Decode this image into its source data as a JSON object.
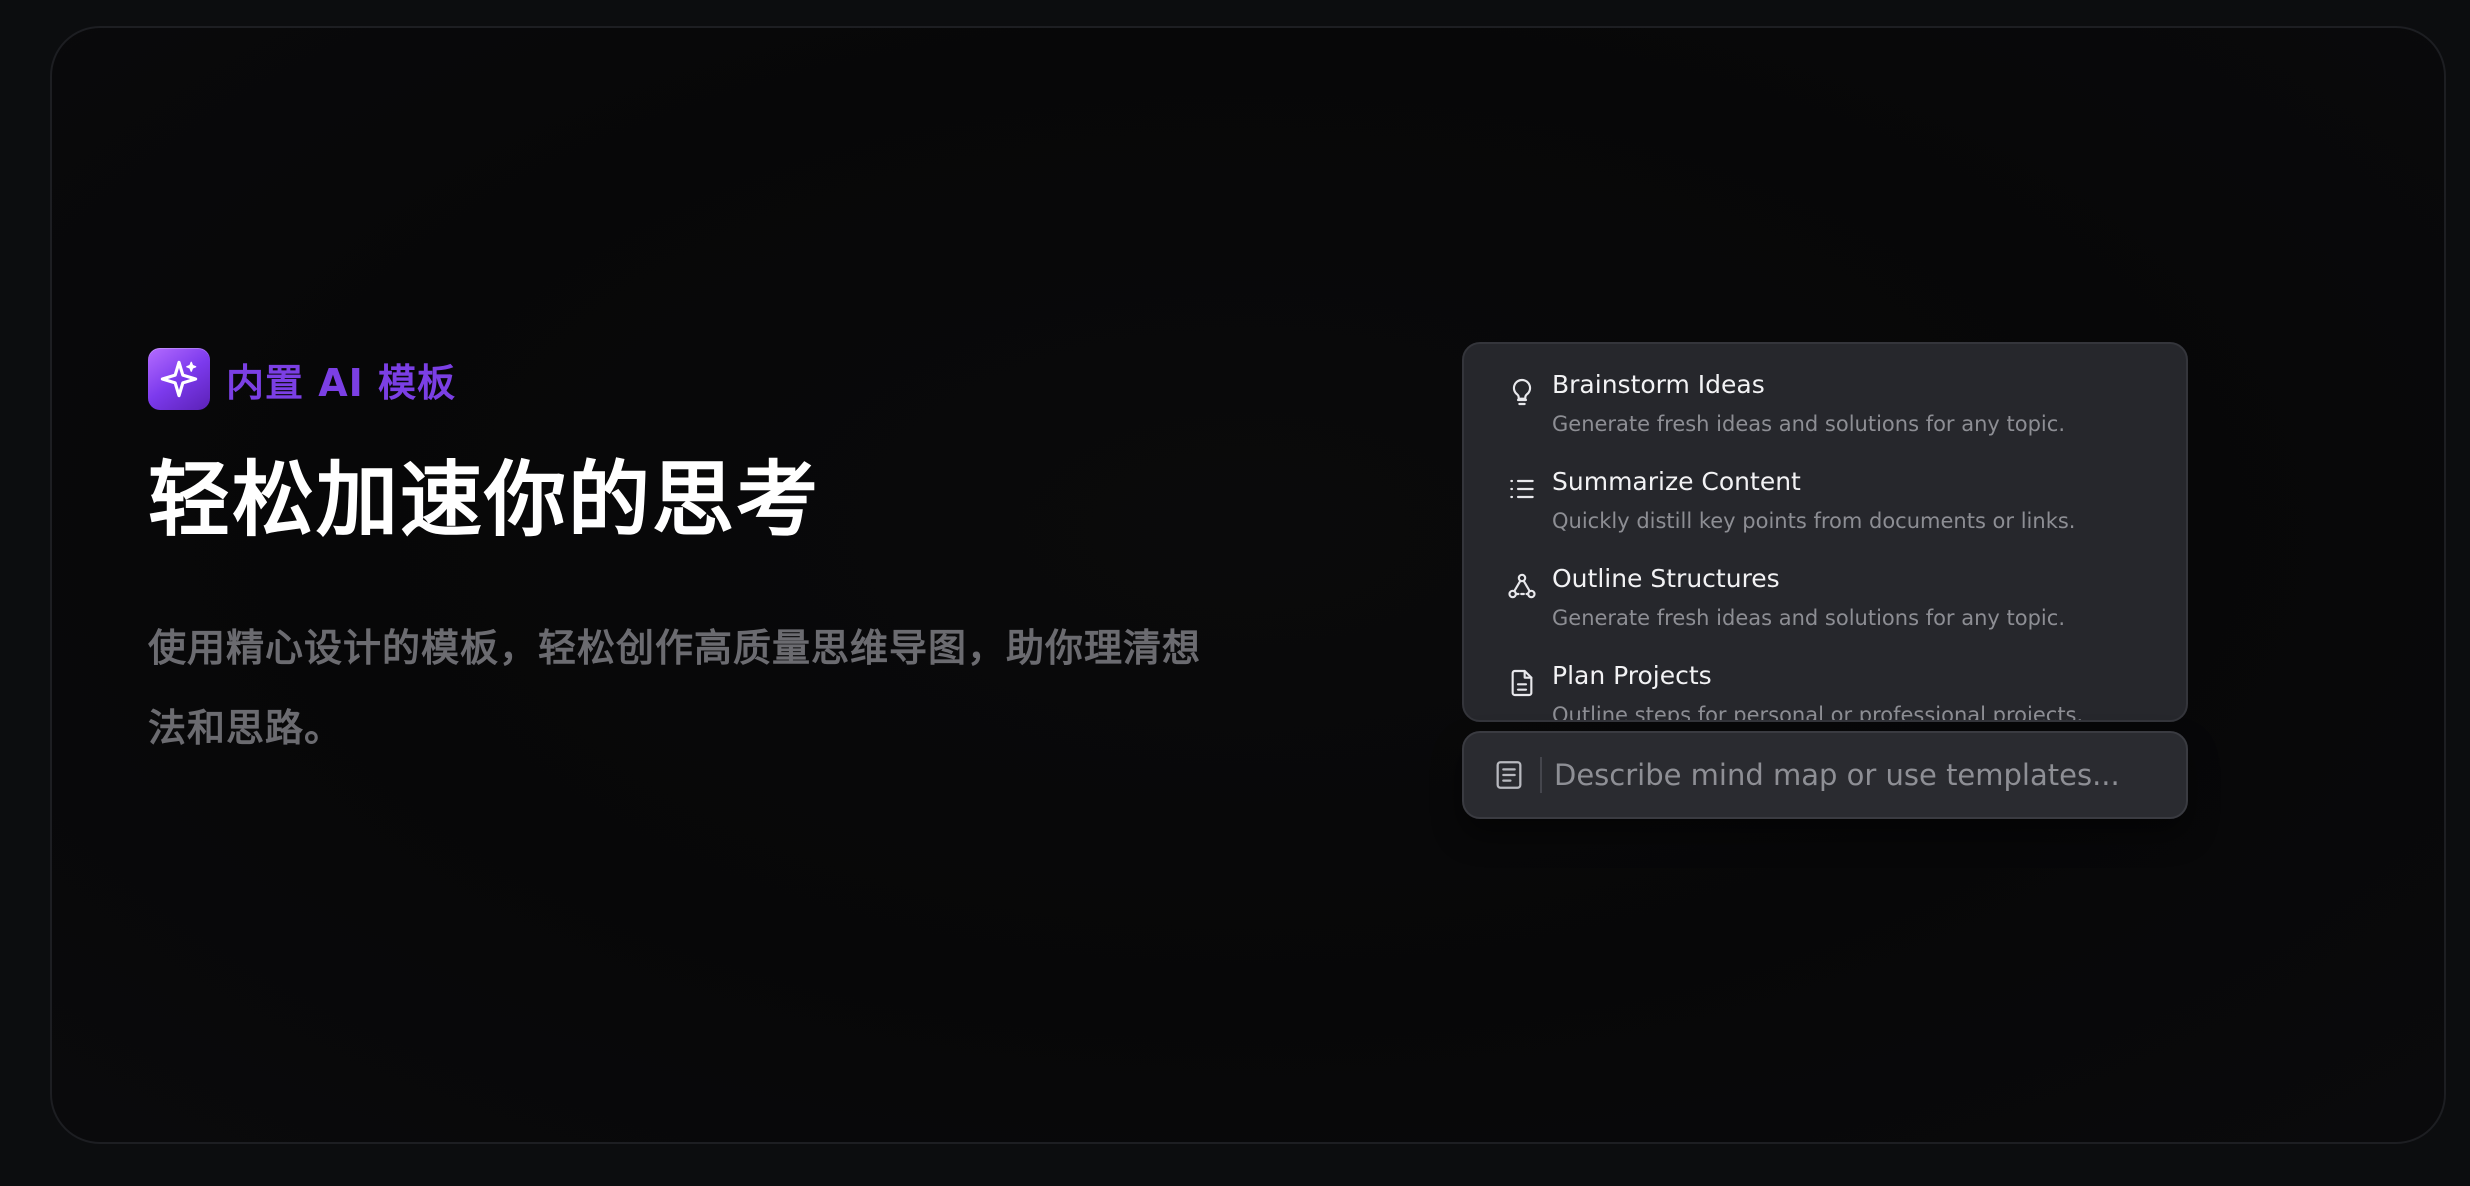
{
  "hero": {
    "badge_label": "内置 AI 模板",
    "headline": "轻松加速你的思考",
    "description": "使用精心设计的模板，轻松创作高质量思维导图，助你理清想法和思路。"
  },
  "templates": [
    {
      "icon": "lightbulb-icon",
      "title": "Brainstorm Ideas",
      "description": "Generate fresh ideas and solutions for any topic."
    },
    {
      "icon": "list-icon",
      "title": "Summarize Content",
      "description": "Quickly distill key points from documents or links."
    },
    {
      "icon": "outline-structure-icon",
      "title": "Outline Structures",
      "description": "Generate fresh ideas and solutions for any topic."
    },
    {
      "icon": "document-icon",
      "title": "Plan Projects",
      "description": "Outline steps for personal or professional projects."
    }
  ],
  "input": {
    "placeholder": "Describe mind map or use templates..."
  },
  "colors": {
    "accent": "#7b3fe4",
    "panel": "#26272c",
    "background": "#0c0d0f"
  }
}
